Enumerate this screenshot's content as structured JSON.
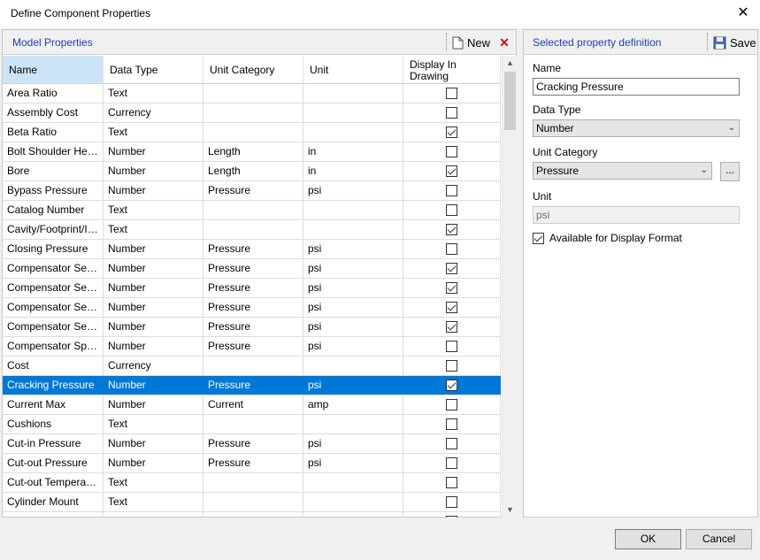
{
  "window": {
    "title": "Define Component Properties",
    "close_glyph": "✕"
  },
  "left": {
    "title": "Model Properties",
    "new_label": "New",
    "delete_glyph": "✕",
    "columns": [
      "Name",
      "Data Type",
      "Unit Category",
      "Unit",
      "Display In Drawing"
    ],
    "rows": [
      {
        "name": "Area Ratio",
        "type": "Text",
        "cat": "",
        "unit": "",
        "display": false
      },
      {
        "name": "Assembly Cost",
        "type": "Currency",
        "cat": "",
        "unit": "",
        "display": false
      },
      {
        "name": "Beta Ratio",
        "type": "Text",
        "cat": "",
        "unit": "",
        "display": true
      },
      {
        "name": "Bolt Shoulder Height",
        "type": "Number",
        "cat": "Length",
        "unit": "in",
        "display": false
      },
      {
        "name": "Bore",
        "type": "Number",
        "cat": "Length",
        "unit": "in",
        "display": true
      },
      {
        "name": "Bypass Pressure",
        "type": "Number",
        "cat": "Pressure",
        "unit": "psi",
        "display": false
      },
      {
        "name": "Catalog Number",
        "type": "Text",
        "cat": "",
        "unit": "",
        "display": false
      },
      {
        "name": "Cavity/Footprint/Int...",
        "type": "Text",
        "cat": "",
        "unit": "",
        "display": true
      },
      {
        "name": "Closing Pressure",
        "type": "Number",
        "cat": "Pressure",
        "unit": "psi",
        "display": false
      },
      {
        "name": "Compensator Setting",
        "type": "Number",
        "cat": "Pressure",
        "unit": "psi",
        "display": true
      },
      {
        "name": "Compensator Settin...",
        "type": "Number",
        "cat": "Pressure",
        "unit": "psi",
        "display": true
      },
      {
        "name": "Compensator Settin...",
        "type": "Number",
        "cat": "Pressure",
        "unit": "psi",
        "display": true
      },
      {
        "name": "Compensator Settin...",
        "type": "Number",
        "cat": "Pressure",
        "unit": "psi",
        "display": true
      },
      {
        "name": "Compensator Spring...",
        "type": "Number",
        "cat": "Pressure",
        "unit": "psi",
        "display": false
      },
      {
        "name": "Cost",
        "type": "Currency",
        "cat": "",
        "unit": "",
        "display": false
      },
      {
        "name": "Cracking Pressure",
        "type": "Number",
        "cat": "Pressure",
        "unit": "psi",
        "display": true,
        "selected": true
      },
      {
        "name": "Current Max",
        "type": "Number",
        "cat": "Current",
        "unit": "amp",
        "display": false
      },
      {
        "name": "Cushions",
        "type": "Text",
        "cat": "",
        "unit": "",
        "display": false
      },
      {
        "name": "Cut-in Pressure",
        "type": "Number",
        "cat": "Pressure",
        "unit": "psi",
        "display": false
      },
      {
        "name": "Cut-out Pressure",
        "type": "Number",
        "cat": "Pressure",
        "unit": "psi",
        "display": false
      },
      {
        "name": "Cut-out Temperature",
        "type": "Text",
        "cat": "",
        "unit": "",
        "display": false
      },
      {
        "name": "Cylinder Mount",
        "type": "Text",
        "cat": "",
        "unit": "",
        "display": false
      },
      {
        "name": "",
        "type": "",
        "cat": "",
        "unit": "",
        "display": false
      }
    ]
  },
  "right": {
    "title": "Selected property definition",
    "save_label": "Save",
    "name_label": "Name",
    "name_value": "Cracking Pressure",
    "datatype_label": "Data Type",
    "datatype_value": "Number",
    "unitcat_label": "Unit Category",
    "unitcat_value": "Pressure",
    "browse_label": "...",
    "unit_label": "Unit",
    "unit_value": "psi",
    "available_label": "Available for Display Format",
    "available_checked": true
  },
  "buttons": {
    "ok": "OK",
    "cancel": "Cancel"
  },
  "colors": {
    "selection": "#0078d7",
    "panel_title": "#1a3fb4",
    "delete_red": "#d01010"
  }
}
